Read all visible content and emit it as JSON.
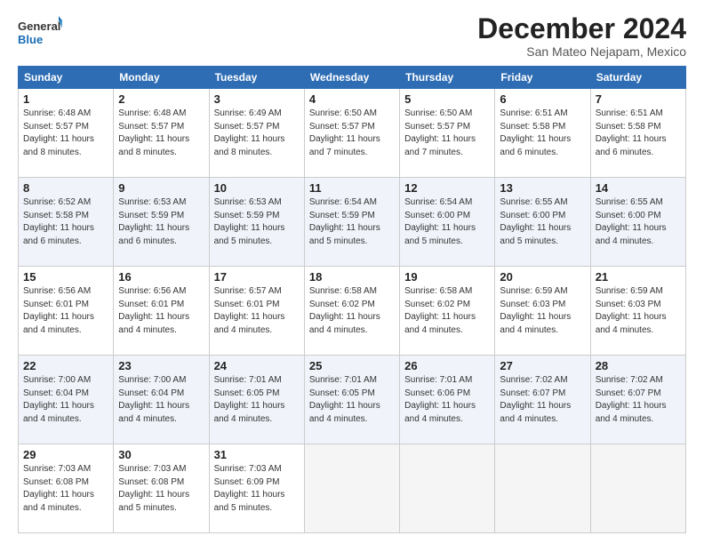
{
  "logo": {
    "line1": "General",
    "line2": "Blue"
  },
  "title": "December 2024",
  "location": "San Mateo Nejapam, Mexico",
  "days_header": [
    "Sunday",
    "Monday",
    "Tuesday",
    "Wednesday",
    "Thursday",
    "Friday",
    "Saturday"
  ],
  "weeks": [
    [
      {
        "day": "1",
        "sunrise": "6:48 AM",
        "sunset": "5:57 PM",
        "daylight": "11 hours and 8 minutes."
      },
      {
        "day": "2",
        "sunrise": "6:48 AM",
        "sunset": "5:57 PM",
        "daylight": "11 hours and 8 minutes."
      },
      {
        "day": "3",
        "sunrise": "6:49 AM",
        "sunset": "5:57 PM",
        "daylight": "11 hours and 8 minutes."
      },
      {
        "day": "4",
        "sunrise": "6:50 AM",
        "sunset": "5:57 PM",
        "daylight": "11 hours and 7 minutes."
      },
      {
        "day": "5",
        "sunrise": "6:50 AM",
        "sunset": "5:57 PM",
        "daylight": "11 hours and 7 minutes."
      },
      {
        "day": "6",
        "sunrise": "6:51 AM",
        "sunset": "5:58 PM",
        "daylight": "11 hours and 6 minutes."
      },
      {
        "day": "7",
        "sunrise": "6:51 AM",
        "sunset": "5:58 PM",
        "daylight": "11 hours and 6 minutes."
      }
    ],
    [
      {
        "day": "8",
        "sunrise": "6:52 AM",
        "sunset": "5:58 PM",
        "daylight": "11 hours and 6 minutes."
      },
      {
        "day": "9",
        "sunrise": "6:53 AM",
        "sunset": "5:59 PM",
        "daylight": "11 hours and 6 minutes."
      },
      {
        "day": "10",
        "sunrise": "6:53 AM",
        "sunset": "5:59 PM",
        "daylight": "11 hours and 5 minutes."
      },
      {
        "day": "11",
        "sunrise": "6:54 AM",
        "sunset": "5:59 PM",
        "daylight": "11 hours and 5 minutes."
      },
      {
        "day": "12",
        "sunrise": "6:54 AM",
        "sunset": "6:00 PM",
        "daylight": "11 hours and 5 minutes."
      },
      {
        "day": "13",
        "sunrise": "6:55 AM",
        "sunset": "6:00 PM",
        "daylight": "11 hours and 5 minutes."
      },
      {
        "day": "14",
        "sunrise": "6:55 AM",
        "sunset": "6:00 PM",
        "daylight": "11 hours and 4 minutes."
      }
    ],
    [
      {
        "day": "15",
        "sunrise": "6:56 AM",
        "sunset": "6:01 PM",
        "daylight": "11 hours and 4 minutes."
      },
      {
        "day": "16",
        "sunrise": "6:56 AM",
        "sunset": "6:01 PM",
        "daylight": "11 hours and 4 minutes."
      },
      {
        "day": "17",
        "sunrise": "6:57 AM",
        "sunset": "6:01 PM",
        "daylight": "11 hours and 4 minutes."
      },
      {
        "day": "18",
        "sunrise": "6:58 AM",
        "sunset": "6:02 PM",
        "daylight": "11 hours and 4 minutes."
      },
      {
        "day": "19",
        "sunrise": "6:58 AM",
        "sunset": "6:02 PM",
        "daylight": "11 hours and 4 minutes."
      },
      {
        "day": "20",
        "sunrise": "6:59 AM",
        "sunset": "6:03 PM",
        "daylight": "11 hours and 4 minutes."
      },
      {
        "day": "21",
        "sunrise": "6:59 AM",
        "sunset": "6:03 PM",
        "daylight": "11 hours and 4 minutes."
      }
    ],
    [
      {
        "day": "22",
        "sunrise": "7:00 AM",
        "sunset": "6:04 PM",
        "daylight": "11 hours and 4 minutes."
      },
      {
        "day": "23",
        "sunrise": "7:00 AM",
        "sunset": "6:04 PM",
        "daylight": "11 hours and 4 minutes."
      },
      {
        "day": "24",
        "sunrise": "7:01 AM",
        "sunset": "6:05 PM",
        "daylight": "11 hours and 4 minutes."
      },
      {
        "day": "25",
        "sunrise": "7:01 AM",
        "sunset": "6:05 PM",
        "daylight": "11 hours and 4 minutes."
      },
      {
        "day": "26",
        "sunrise": "7:01 AM",
        "sunset": "6:06 PM",
        "daylight": "11 hours and 4 minutes."
      },
      {
        "day": "27",
        "sunrise": "7:02 AM",
        "sunset": "6:07 PM",
        "daylight": "11 hours and 4 minutes."
      },
      {
        "day": "28",
        "sunrise": "7:02 AM",
        "sunset": "6:07 PM",
        "daylight": "11 hours and 4 minutes."
      }
    ],
    [
      {
        "day": "29",
        "sunrise": "7:03 AM",
        "sunset": "6:08 PM",
        "daylight": "11 hours and 4 minutes."
      },
      {
        "day": "30",
        "sunrise": "7:03 AM",
        "sunset": "6:08 PM",
        "daylight": "11 hours and 5 minutes."
      },
      {
        "day": "31",
        "sunrise": "7:03 AM",
        "sunset": "6:09 PM",
        "daylight": "11 hours and 5 minutes."
      },
      null,
      null,
      null,
      null
    ]
  ]
}
